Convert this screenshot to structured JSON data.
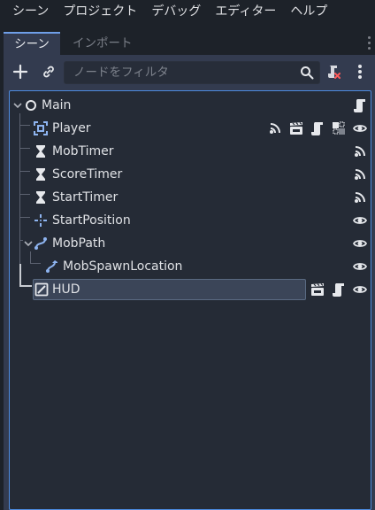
{
  "menubar": {
    "items": [
      "シーン",
      "プロジェクト",
      "デバッグ",
      "エディター",
      "ヘルプ"
    ]
  },
  "tabs": [
    {
      "label": "シーン",
      "active": true
    },
    {
      "label": "インポート",
      "active": false
    }
  ],
  "toolbar": {
    "filter_placeholder": "ノードをフィルタ",
    "icons": [
      "add-node-icon",
      "instance-link-icon",
      "search-icon",
      "script-filter-icon",
      "more-menu-icon"
    ]
  },
  "tree": {
    "nodes": [
      {
        "name": "Main",
        "icon": "node-circle-icon",
        "depth": 0,
        "expanded": true,
        "badges": [
          "script-icon"
        ]
      },
      {
        "name": "Player",
        "icon": "area2d-icon",
        "depth": 1,
        "badges": [
          "signal-icon",
          "scene-instance-icon",
          "script-icon",
          "group-icon",
          "visibility-eye-icon"
        ]
      },
      {
        "name": "MobTimer",
        "icon": "timer-icon",
        "depth": 1,
        "badges": [
          "signal-icon"
        ]
      },
      {
        "name": "ScoreTimer",
        "icon": "timer-icon",
        "depth": 1,
        "badges": [
          "signal-icon"
        ]
      },
      {
        "name": "StartTimer",
        "icon": "timer-icon",
        "depth": 1,
        "badges": [
          "signal-icon"
        ]
      },
      {
        "name": "StartPosition",
        "icon": "marker2d-icon",
        "depth": 1,
        "badges": [
          "visibility-eye-icon"
        ]
      },
      {
        "name": "MobPath",
        "icon": "path2d-icon",
        "depth": 1,
        "expanded": true,
        "badges": [
          "visibility-eye-icon"
        ]
      },
      {
        "name": "MobSpawnLocation",
        "icon": "pathfollow2d-icon",
        "depth": 2,
        "badges": [
          "visibility-eye-icon"
        ]
      },
      {
        "name": "HUD",
        "icon": "canvaslayer-icon",
        "depth": 1,
        "selected": true,
        "badges": [
          "scene-instance-icon",
          "script-icon",
          "visibility-eye-icon"
        ]
      }
    ]
  },
  "colors": {
    "background": "#1d2229",
    "panel": "#333b4f",
    "tree_background": "#252b36",
    "accent": "#4d8be0",
    "node_blue": "#8eb4f0"
  }
}
